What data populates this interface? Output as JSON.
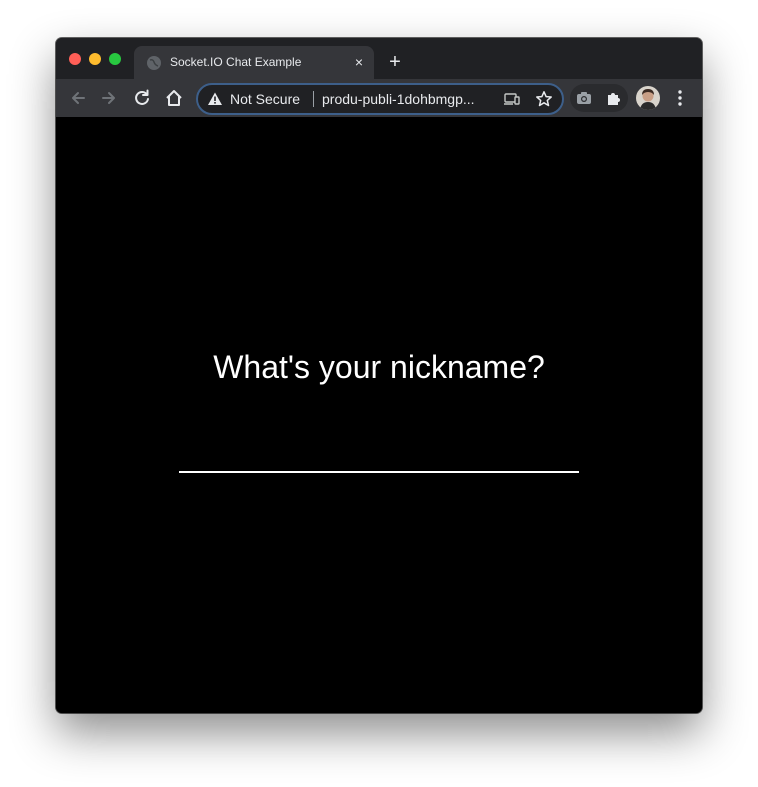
{
  "browser": {
    "tab": {
      "title": "Socket.IO Chat Example",
      "close_glyph": "×"
    },
    "new_tab_glyph": "+",
    "toolbar": {
      "security_label": "Not Secure",
      "url": "produ-publi-1dohbmgp..."
    },
    "icons": [
      "back-icon",
      "forward-icon",
      "reload-icon",
      "home-icon",
      "warning-icon",
      "cast-icon",
      "star-icon",
      "camera-icon",
      "puzzle-icon",
      "menu-icon"
    ]
  },
  "page": {
    "prompt": "What's your nickname?",
    "nickname_value": ""
  }
}
